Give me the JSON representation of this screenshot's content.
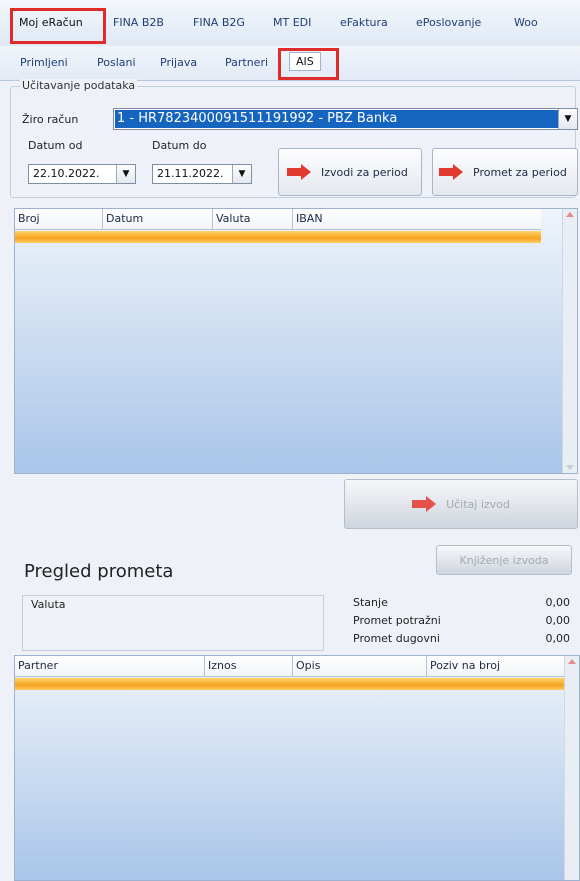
{
  "top_tabs": [
    {
      "label": "Moj eRačun",
      "active": true
    },
    {
      "label": "FINA B2B",
      "active": false
    },
    {
      "label": "FINA B2G",
      "active": false
    },
    {
      "label": "MT EDI",
      "active": false
    },
    {
      "label": "eFaktura",
      "active": false
    },
    {
      "label": "ePoslovanje",
      "active": false
    },
    {
      "label": "Woo",
      "active": false
    }
  ],
  "sub_tabs": [
    {
      "label": "Primljeni",
      "active": false
    },
    {
      "label": "Poslani",
      "active": false
    },
    {
      "label": "Prijava",
      "active": false
    },
    {
      "label": "Partneri",
      "active": false
    },
    {
      "label": "AIS",
      "active": true
    }
  ],
  "loading_group": {
    "legend": "Učitavanje podataka",
    "account_label": "Žiro račun",
    "account_value": "1 - HR7823400091511191992 - PBZ Banka",
    "date_from_label": "Datum od",
    "date_from_value": "22.10.2022.",
    "date_to_label": "Datum do",
    "date_to_value": "21.11.2022.",
    "btn_statements": "Izvodi za period",
    "btn_turnover": "Promet za period"
  },
  "statements_grid": {
    "columns": [
      "Broj",
      "Datum",
      "Valuta",
      "IBAN"
    ]
  },
  "btn_load_statement": "Učitaj izvod",
  "btn_post_statement": "Knjiženje izvoda",
  "turnover": {
    "title": "Pregled prometa",
    "valuta_label": "Valuta",
    "summary": [
      {
        "label": "Stanje",
        "value": "0,00"
      },
      {
        "label": "Promet potražni",
        "value": "0,00"
      },
      {
        "label": "Promet dugovni",
        "value": "0,00"
      }
    ]
  },
  "turnover_grid": {
    "columns": [
      "Partner",
      "Iznos",
      "Opis",
      "Poziv na broj"
    ]
  },
  "colors": {
    "highlight_red": "#e02b2b",
    "selection_blue": "#1564c0",
    "row_orange": "#f7a41f"
  }
}
